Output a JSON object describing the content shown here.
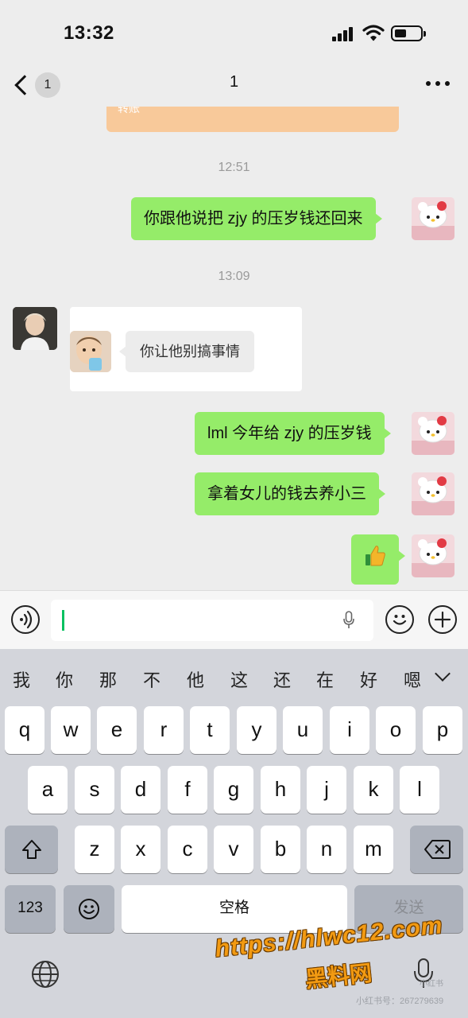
{
  "status_bar": {
    "time": "13:32"
  },
  "nav": {
    "back_badge": "1",
    "title": "1"
  },
  "chat": {
    "transfer_label": "转账",
    "timestamps": [
      "12:51",
      "13:09"
    ],
    "messages": {
      "m1": "你跟他说把 zjy 的压岁钱还回来",
      "m2_inner": "你让他别搞事情",
      "m3": "lml 今年给 zjy 的压岁钱",
      "m4": "拿着女儿的钱去养小三",
      "m5": "👍"
    }
  },
  "candidates": [
    "我",
    "你",
    "那",
    "不",
    "他",
    "这",
    "还",
    "在",
    "好",
    "嗯"
  ],
  "keyboard": {
    "row1": [
      "q",
      "w",
      "e",
      "r",
      "t",
      "y",
      "u",
      "i",
      "o",
      "p"
    ],
    "row2": [
      "a",
      "s",
      "d",
      "f",
      "g",
      "h",
      "j",
      "k",
      "l"
    ],
    "row3": [
      "z",
      "x",
      "c",
      "v",
      "b",
      "n",
      "m"
    ],
    "num": "123",
    "space": "空格",
    "send": "发送"
  },
  "watermark": {
    "url": "https://hlwc12.com",
    "name": "黑料网",
    "xhs": "小红书号：267279639",
    "xhs_logo": "小红书"
  },
  "colors": {
    "bubble_green": "#95ec69",
    "caret_green": "#07c160",
    "transfer_orange": "#f8c99a"
  }
}
